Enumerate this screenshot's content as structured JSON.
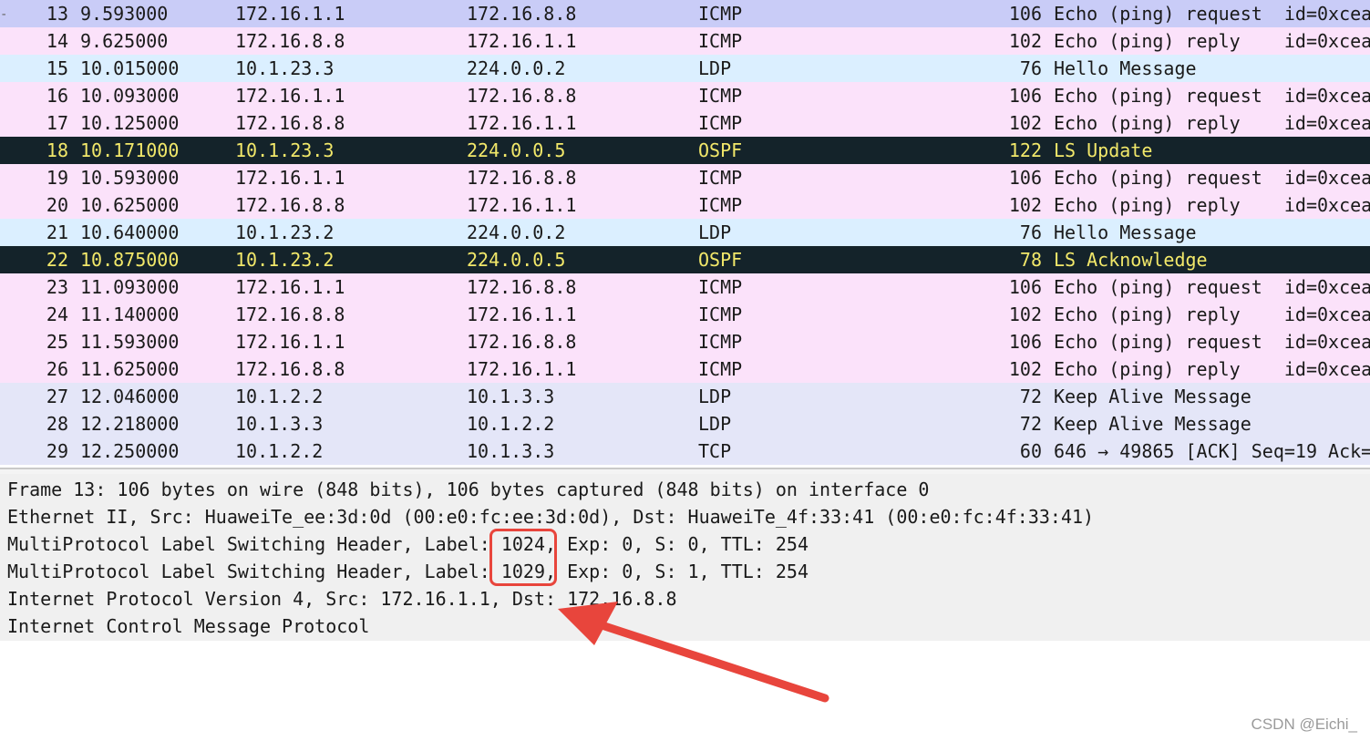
{
  "colors": {
    "icmp_bg": "#fbe2fa",
    "icmp_selected_bg": "#c9ccf7",
    "ldp_udp_bg": "#dbefff",
    "ldp_tcp_bg": "#e4e6f8",
    "ospf_bg": "#14232a",
    "ospf_fg": "#f2e86a",
    "text": "#1a1a1a",
    "annotation_red": "#e8453c"
  },
  "packets": [
    {
      "no": "13",
      "time": "9.593000",
      "src": "172.16.1.1",
      "dst": "172.16.8.8",
      "proto": "ICMP",
      "len": "106",
      "info": "Echo (ping) request  id=0xcea",
      "style": "icmp_selected"
    },
    {
      "no": "14",
      "time": "9.625000",
      "src": "172.16.8.8",
      "dst": "172.16.1.1",
      "proto": "ICMP",
      "len": "102",
      "info": "Echo (ping) reply    id=0xcea",
      "style": "icmp"
    },
    {
      "no": "15",
      "time": "10.015000",
      "src": "10.1.23.3",
      "dst": "224.0.0.2",
      "proto": "LDP",
      "len": "76",
      "info": "Hello Message",
      "style": "ldp_udp"
    },
    {
      "no": "16",
      "time": "10.093000",
      "src": "172.16.1.1",
      "dst": "172.16.8.8",
      "proto": "ICMP",
      "len": "106",
      "info": "Echo (ping) request  id=0xcea",
      "style": "icmp"
    },
    {
      "no": "17",
      "time": "10.125000",
      "src": "172.16.8.8",
      "dst": "172.16.1.1",
      "proto": "ICMP",
      "len": "102",
      "info": "Echo (ping) reply    id=0xcea",
      "style": "icmp"
    },
    {
      "no": "18",
      "time": "10.171000",
      "src": "10.1.23.3",
      "dst": "224.0.0.5",
      "proto": "OSPF",
      "len": "122",
      "info": "LS Update",
      "style": "ospf"
    },
    {
      "no": "19",
      "time": "10.593000",
      "src": "172.16.1.1",
      "dst": "172.16.8.8",
      "proto": "ICMP",
      "len": "106",
      "info": "Echo (ping) request  id=0xcea",
      "style": "icmp"
    },
    {
      "no": "20",
      "time": "10.625000",
      "src": "172.16.8.8",
      "dst": "172.16.1.1",
      "proto": "ICMP",
      "len": "102",
      "info": "Echo (ping) reply    id=0xcea",
      "style": "icmp"
    },
    {
      "no": "21",
      "time": "10.640000",
      "src": "10.1.23.2",
      "dst": "224.0.0.2",
      "proto": "LDP",
      "len": "76",
      "info": "Hello Message",
      "style": "ldp_udp"
    },
    {
      "no": "22",
      "time": "10.875000",
      "src": "10.1.23.2",
      "dst": "224.0.0.5",
      "proto": "OSPF",
      "len": "78",
      "info": "LS Acknowledge",
      "style": "ospf"
    },
    {
      "no": "23",
      "time": "11.093000",
      "src": "172.16.1.1",
      "dst": "172.16.8.8",
      "proto": "ICMP",
      "len": "106",
      "info": "Echo (ping) request  id=0xcea",
      "style": "icmp"
    },
    {
      "no": "24",
      "time": "11.140000",
      "src": "172.16.8.8",
      "dst": "172.16.1.1",
      "proto": "ICMP",
      "len": "102",
      "info": "Echo (ping) reply    id=0xcea",
      "style": "icmp"
    },
    {
      "no": "25",
      "time": "11.593000",
      "src": "172.16.1.1",
      "dst": "172.16.8.8",
      "proto": "ICMP",
      "len": "106",
      "info": "Echo (ping) request  id=0xcea",
      "style": "icmp"
    },
    {
      "no": "26",
      "time": "11.625000",
      "src": "172.16.8.8",
      "dst": "172.16.1.1",
      "proto": "ICMP",
      "len": "102",
      "info": "Echo (ping) reply    id=0xcea",
      "style": "icmp"
    },
    {
      "no": "27",
      "time": "12.046000",
      "src": "10.1.2.2",
      "dst": "10.1.3.3",
      "proto": "LDP",
      "len": "72",
      "info": "Keep Alive Message",
      "style": "ldp_tcp"
    },
    {
      "no": "28",
      "time": "12.218000",
      "src": "10.1.3.3",
      "dst": "10.1.2.2",
      "proto": "LDP",
      "len": "72",
      "info": "Keep Alive Message",
      "style": "ldp_tcp"
    },
    {
      "no": "29",
      "time": "12.250000",
      "src": "10.1.2.2",
      "dst": "10.1.3.3",
      "proto": "TCP",
      "len": "60",
      "info": "646 → 49865 [ACK] Seq=19 Ack=",
      "style": "ldp_tcp"
    }
  ],
  "details": [
    "Frame 13: 106 bytes on wire (848 bits), 106 bytes captured (848 bits) on interface 0",
    "Ethernet II, Src: HuaweiTe_ee:3d:0d (00:e0:fc:ee:3d:0d), Dst: HuaweiTe_4f:33:41 (00:e0:fc:4f:33:41)",
    "MultiProtocol Label Switching Header, Label: 1024, Exp: 0, S: 0, TTL: 254",
    "MultiProtocol Label Switching Header, Label: 1029, Exp: 0, S: 1, TTL: 254",
    "Internet Protocol Version 4, Src: 172.16.1.1, Dst: 172.16.8.8",
    "Internet Control Message Protocol"
  ],
  "watermark": "CSDN @Eichi_"
}
